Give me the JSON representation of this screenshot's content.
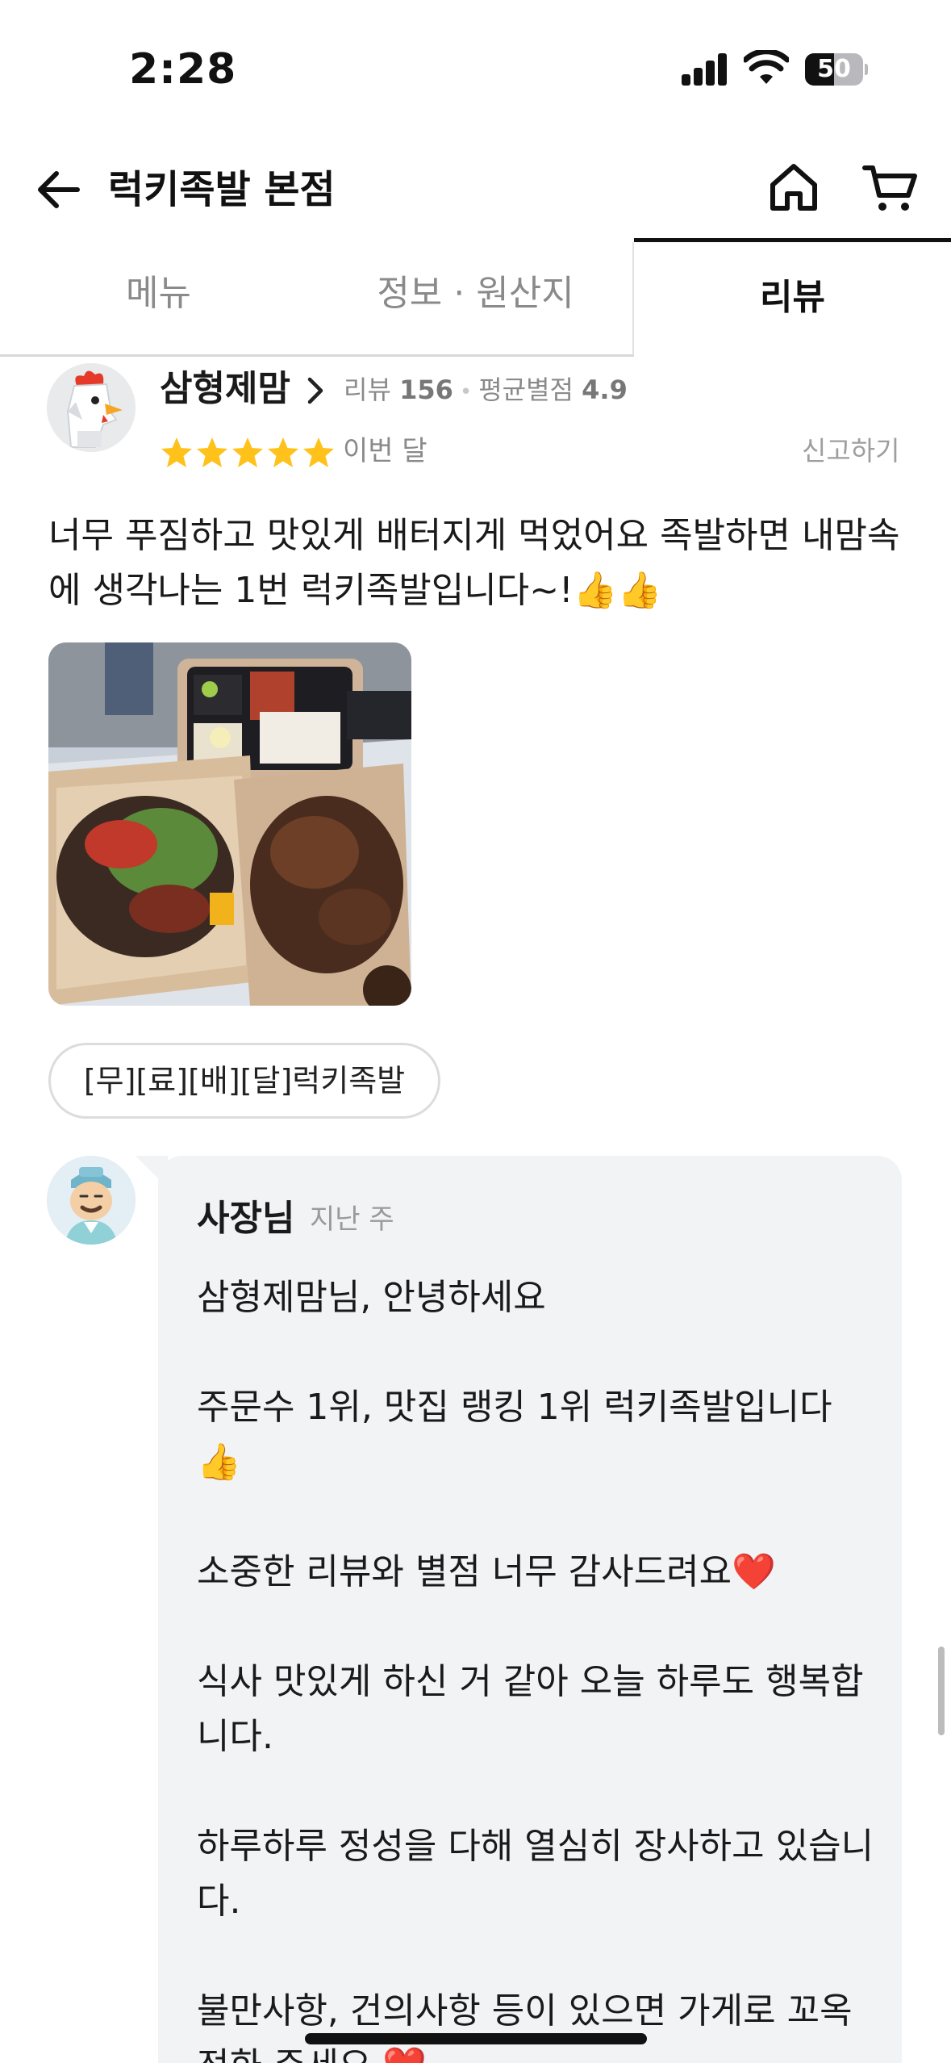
{
  "status_bar": {
    "time": "2:28",
    "battery": "50",
    "battery_level": 0.5
  },
  "header": {
    "title": "럭키족발 본점",
    "icons": [
      "back-arrow-icon",
      "home-icon",
      "cart-icon"
    ]
  },
  "tabs": [
    {
      "label": "메뉴",
      "active": false
    },
    {
      "label": "정보 · 원산지",
      "active": false
    },
    {
      "label": "리뷰",
      "active": true
    }
  ],
  "review": {
    "reviewer_name": "삼형제맘",
    "review_count_label": "리뷰",
    "review_count": "156",
    "avg_rating_label": "평균별점",
    "avg_rating": "4.9",
    "stars": 5,
    "star_color": "#ffc21a",
    "date": "이번 달",
    "report_label": "신고하기",
    "text": "너무 푸짐하고 맛있게 배터지게 먹었어요 족발하면 내맘속에 생각나는 1번 럭키족발입니다~!👍👍",
    "menu_chip": "[무][료][배][달]럭키족발"
  },
  "owner_reply": {
    "label": "사장님",
    "date": "지난 주",
    "text": "삼형제맘님,  안녕하세요\n\n주문수 1위, 맛집 랭킹 1위 럭키족발입니다👍\n\n소중한 리뷰와 별점 너무 감사드려요❤️\n\n식사 맛있게 하신 거 같아 오늘 하루도 행복합니다.\n\n하루하루 정성을 다해 열심히 장사하고 있습니다.\n\n불만사항, 건의사항 등이 있으면 가게로 꼬옥 전화 주세요 ❤️"
  }
}
